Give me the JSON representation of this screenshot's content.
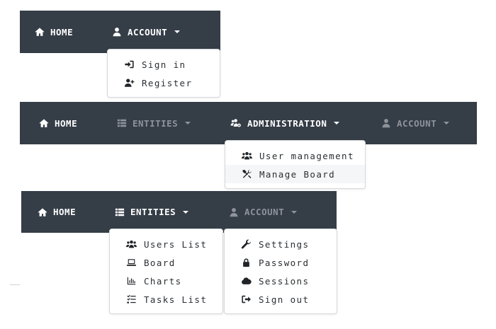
{
  "navbar1": {
    "home": {
      "label": "HOME",
      "icon": "home-icon"
    },
    "account": {
      "label": "ACCOUNT",
      "icon": "user-icon"
    },
    "account_menu": [
      {
        "label": "Sign in",
        "icon": "sign-in-icon"
      },
      {
        "label": "Register",
        "icon": "user-plus-icon"
      }
    ]
  },
  "navbar2": {
    "home": {
      "label": "HOME",
      "icon": "home-icon"
    },
    "entities": {
      "label": "ENTITIES",
      "icon": "list-icon"
    },
    "administration": {
      "label": "ADMINISTRATION",
      "icon": "users-cog-icon"
    },
    "account": {
      "label": "ACCOUNT",
      "icon": "user-icon"
    },
    "administration_menu": [
      {
        "label": "User management",
        "icon": "users-icon"
      },
      {
        "label": "Manage Board",
        "icon": "tools-icon"
      }
    ]
  },
  "navbar3": {
    "home": {
      "label": "HOME",
      "icon": "home-icon"
    },
    "entities": {
      "label": "ENTITIES",
      "icon": "list-icon"
    },
    "account": {
      "label": "ACCOUNT",
      "icon": "user-icon"
    },
    "entities_menu": [
      {
        "label": "Users List",
        "icon": "users-icon"
      },
      {
        "label": "Board",
        "icon": "laptop-icon"
      },
      {
        "label": "Charts",
        "icon": "chart-bar-icon"
      },
      {
        "label": "Tasks List",
        "icon": "tasks-icon"
      }
    ],
    "account_menu": [
      {
        "label": "Settings",
        "icon": "wrench-icon"
      },
      {
        "label": "Password",
        "icon": "lock-icon"
      },
      {
        "label": "Sessions",
        "icon": "cloud-icon"
      },
      {
        "label": "Sign out",
        "icon": "sign-out-icon"
      }
    ]
  },
  "colors": {
    "navbar_bg": "#353d47",
    "nav_active_text": "#ffffff",
    "nav_dim_text": "#8e9399",
    "dropdown_bg": "#ffffff",
    "dropdown_border": "#d6d8db",
    "dropdown_text": "#2b2f33"
  }
}
